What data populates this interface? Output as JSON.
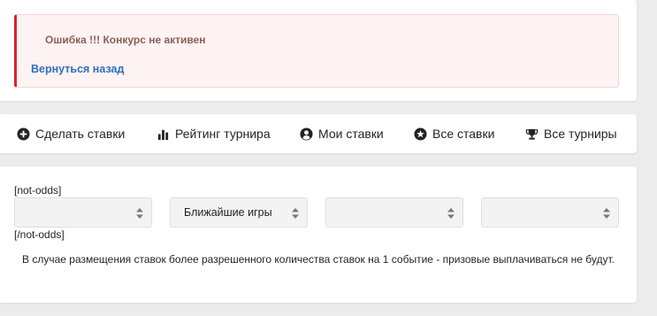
{
  "alert": {
    "message": "Ошибка !!! Конкурс не активен",
    "back_link": "Вернуться назад",
    "accent_color": "#d9232f",
    "link_color": "#2f6fbb"
  },
  "nav": {
    "items": [
      {
        "label": "Сделать ставки",
        "icon": "plus-circle-icon"
      },
      {
        "label": "Рейтинг турнира",
        "icon": "bar-chart-icon"
      },
      {
        "label": "Мои ставки",
        "icon": "user-circle-icon"
      },
      {
        "label": "Все ставки",
        "icon": "star-circle-icon"
      },
      {
        "label": "Все турниры",
        "icon": "trophy-icon"
      }
    ]
  },
  "filters": {
    "open_tag": "[not-odds]",
    "close_tag": "[/not-odds]",
    "selects": [
      {
        "value": ""
      },
      {
        "value": "Ближайшие игры"
      },
      {
        "value": ""
      },
      {
        "value": ""
      }
    ]
  },
  "note": "В случае размещения ставок более разрешенного количества ставок на 1 событие - призовые выплачиваться не будут."
}
